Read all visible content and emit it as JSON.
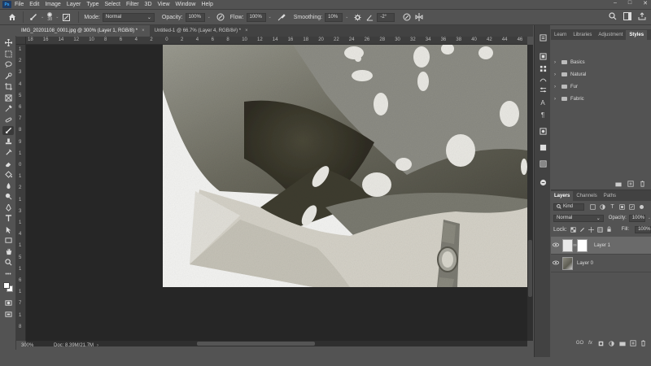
{
  "app": {
    "logo": "Ps"
  },
  "menu": [
    "File",
    "Edit",
    "Image",
    "Layer",
    "Type",
    "Select",
    "Filter",
    "3D",
    "View",
    "Window",
    "Help"
  ],
  "window_controls": {
    "min": "–",
    "max": "□",
    "close": "✕"
  },
  "options": {
    "brush_size": "38",
    "mode_label": "Mode:",
    "mode_value": "Normal",
    "opacity_label": "Opacity:",
    "opacity_value": "100%",
    "flow_label": "Flow:",
    "flow_value": "100%",
    "smoothing_label": "Smoothing:",
    "smoothing_value": "10%",
    "angle_value": "-2°"
  },
  "tabs": [
    {
      "label": "IMG_20201108_0001.jpg @ 300% (Layer 1, RGB/8) *",
      "close": "×"
    },
    {
      "label": "Untitled-1 @ 66.7% (Layer 4, RGB/8#) *",
      "close": "×"
    }
  ],
  "ruler_top_ticks": [
    "18",
    "16",
    "14",
    "12",
    "10",
    "8",
    "6",
    "4",
    "2",
    "0",
    "2",
    "4",
    "6",
    "8",
    "10",
    "12",
    "14",
    "16",
    "18",
    "20",
    "22",
    "24",
    "26",
    "28",
    "30",
    "32",
    "34",
    "36",
    "38",
    "40",
    "42",
    "44",
    "46"
  ],
  "ruler_left_ticks": [
    "1",
    "2",
    "3",
    "4",
    "5",
    "6",
    "7",
    "8",
    "9",
    "1",
    "0",
    "1",
    "2",
    "1",
    "3",
    "1",
    "4",
    "1",
    "5",
    "1",
    "6",
    "1",
    "7",
    "1",
    "8"
  ],
  "status": {
    "zoom": "300%",
    "doc": "Doc: 8.39M/21.7M"
  },
  "styles_panel": {
    "tabs": [
      "Learn",
      "Libraries",
      "Adjustment",
      "Styles"
    ],
    "folders": [
      "Basics",
      "Natural",
      "Fur",
      "Fabric"
    ]
  },
  "layers_panel": {
    "tabs": [
      "Layers",
      "Channels",
      "Paths"
    ],
    "kind_label": "Kind",
    "blend_mode": "Normal",
    "opacity_label": "Opacity:",
    "opacity_value": "100%",
    "lock_label": "Lock:",
    "fill_label": "Fill:",
    "fill_value": "100%",
    "layers": [
      {
        "name": "Layer 1",
        "selected": true
      },
      {
        "name": "Layer 0",
        "selected": false
      }
    ]
  },
  "colors": {
    "ui_bg": "#535353",
    "canvas_bg": "#262626",
    "panel_dark": "#424242",
    "selected_layer": "#6a6a6a"
  }
}
